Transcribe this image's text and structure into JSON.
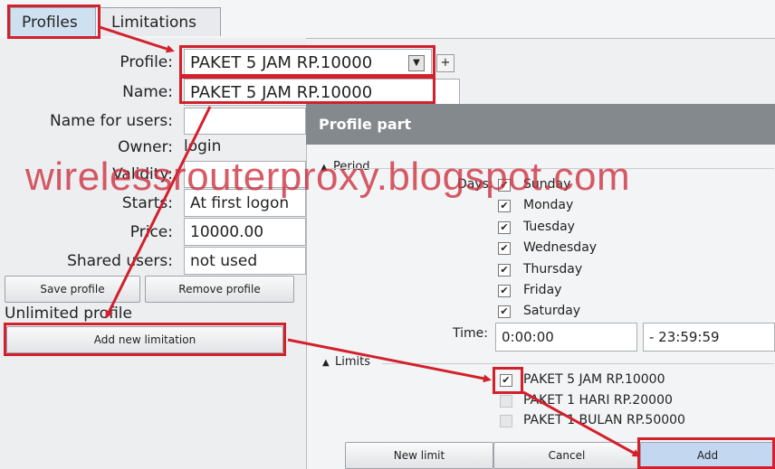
{
  "tabs": [
    {
      "label": "Profiles"
    },
    {
      "label": "Limitations"
    }
  ],
  "form": {
    "profile_label": "Profile:",
    "profile_value": "PAKET 5 JAM RP.10000",
    "add_button": "+",
    "name_label": "Name:",
    "name_value": "PAKET 5 JAM RP.10000",
    "name_for_users_label": "Name for users:",
    "name_for_users_value": "",
    "owner_label": "Owner:",
    "owner_value": "login",
    "validity_label": "Validity:",
    "starts_label": "Starts:",
    "starts_value": "At first logon",
    "price_label": "Price:",
    "price_value": "10000.00",
    "shared_users_label": "Shared users:",
    "shared_users_value": "not used"
  },
  "buttons": {
    "save_profile": "Save profile",
    "remove_profile": "Remove profile",
    "add_new_limitation": "Add new limitation"
  },
  "unlimited_profile_label": "Unlimited profile",
  "dialog": {
    "title": "Profile part",
    "period_title": "Period",
    "days_label": "Days:",
    "days": [
      {
        "label": "Sunday",
        "checked": true
      },
      {
        "label": "Monday",
        "checked": true
      },
      {
        "label": "Tuesday",
        "checked": true
      },
      {
        "label": "Wednesday",
        "checked": true
      },
      {
        "label": "Thursday",
        "checked": true
      },
      {
        "label": "Friday",
        "checked": true
      },
      {
        "label": "Saturday",
        "checked": true
      }
    ],
    "time_label": "Time:",
    "time_from": "0:00:00",
    "time_to": "- 23:59:59",
    "limits_title": "Limits",
    "limits": [
      {
        "label": "PAKET 5 JAM RP.10000",
        "checked": true
      },
      {
        "label": "PAKET 1 HARI RP.20000",
        "checked": false
      },
      {
        "label": "PAKET 1 BULAN RP.50000",
        "checked": false
      }
    ],
    "new_limit_button": "New limit",
    "cancel_button": "Cancel",
    "add_button": "Add"
  },
  "watermark": "wirelessrouterproxy.blogspot.com",
  "icons": {
    "triangle": "▲",
    "dropdown": "▼",
    "check": "✔"
  },
  "colors": {
    "highlight": "#d2202c",
    "dialog_title_bg": "#84898e",
    "active_tab_bg": "#cfe0f1",
    "add_button_bg": "#c3d8f0"
  }
}
